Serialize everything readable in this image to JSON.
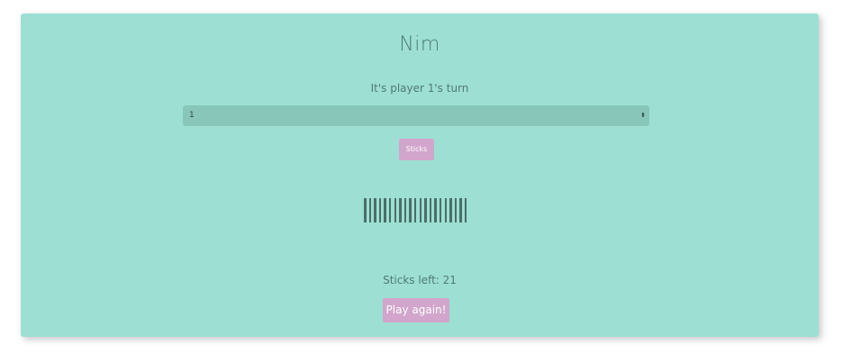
{
  "app": {
    "title": "Nim"
  },
  "status": {
    "turn_text": "It's player 1's turn",
    "sticks_left_text": "Sticks left: 21",
    "sticks_left": 21
  },
  "take_select": {
    "value": "1"
  },
  "buttons": {
    "sticks_label": "Sticks",
    "play_again_label": "Play again!"
  },
  "colors": {
    "card_bg": "#9ddfd3",
    "select_bg": "#89c6ba",
    "button_bg": "#d2a5cc",
    "stick": "#4a6e68"
  }
}
